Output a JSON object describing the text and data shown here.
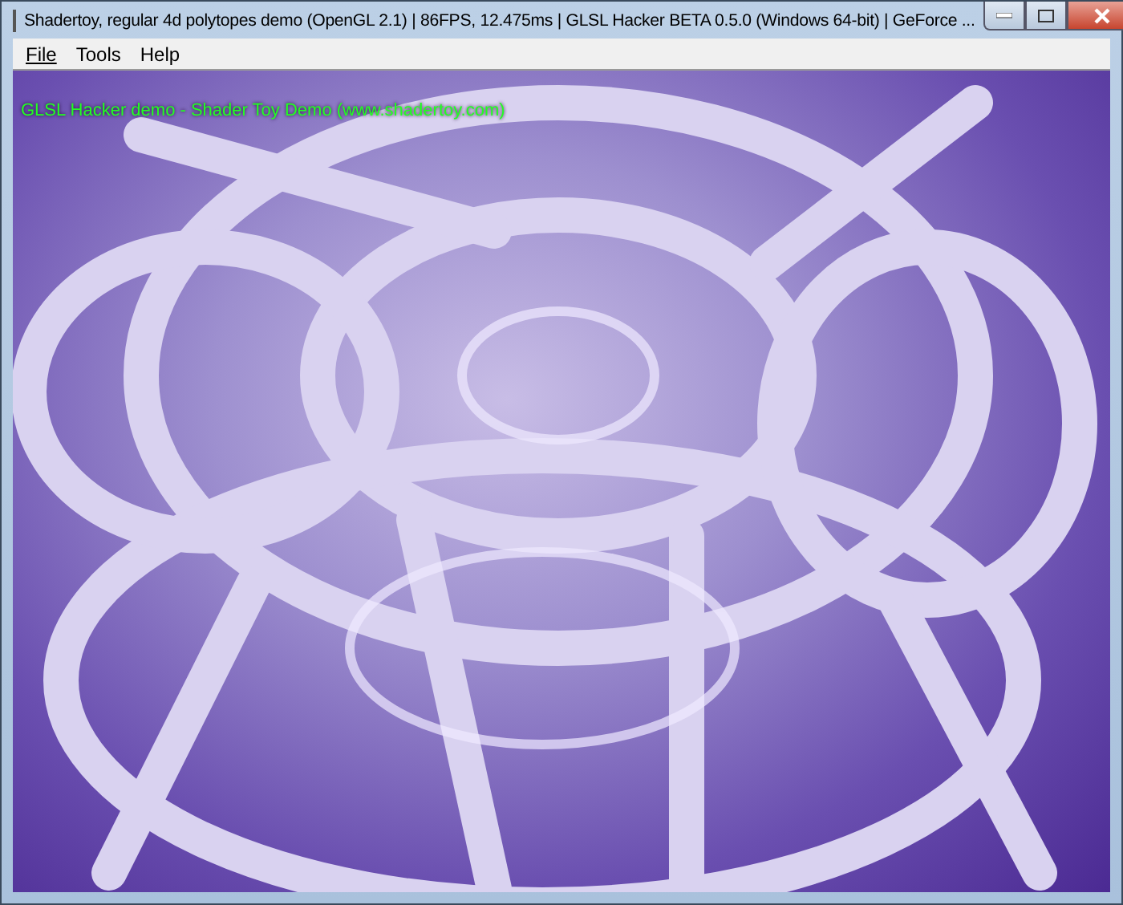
{
  "window": {
    "title": "Shadertoy, regular 4d polytopes demo (OpenGL 2.1) | 86FPS, 12.475ms | GLSL Hacker BETA 0.5.0 (Windows 64-bit) | GeForce ..."
  },
  "menu": [
    {
      "label": "File",
      "mnemonic_underline": true
    },
    {
      "label": "Tools"
    },
    {
      "label": "Help"
    }
  ],
  "viewport": {
    "overlay_text": "GLSL Hacker demo - Shader Toy Demo (www.shadertoy.com)"
  }
}
